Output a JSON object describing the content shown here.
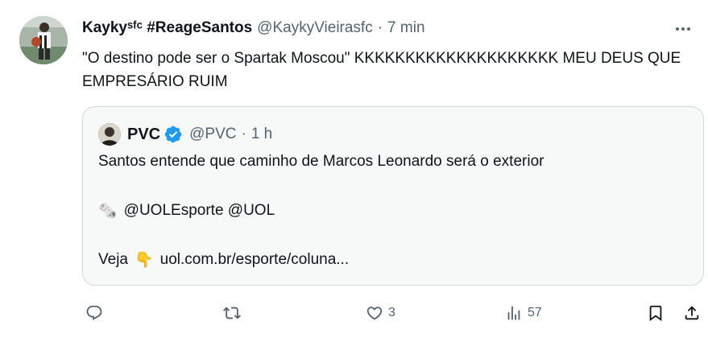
{
  "tweet": {
    "author_name": "Kaykyˢᶠᶜ #ReageSantos",
    "author_handle": "@KaykyVieirasfc",
    "separator": "·",
    "time": "7 min",
    "text": "\"O destino pode ser o Spartak Moscou\" KKKKKKKKKKKKKKKKKKKK MEU DEUS QUE EMPRESÁRIO RUIM"
  },
  "quote": {
    "author_name": "PVC",
    "author_handle": "@PVC",
    "separator": "·",
    "time": "1 h",
    "line1": "Santos entende que caminho de Marcos Leonardo será o exterior",
    "line2_emoji": "🗞️",
    "line2_text": "@UOLEsporte @UOL",
    "line3_text": "Veja",
    "line3_emoji": "👇",
    "line3_link": "uol.com.br/esporte/coluna..."
  },
  "actions": {
    "reply_count": "",
    "retweet_count": "",
    "like_count": "3",
    "views_count": "57"
  },
  "colors": {
    "text_primary": "#0f1419",
    "text_secondary": "#536471",
    "verified_blue": "#1d9bf0",
    "quote_border": "#cfd9de",
    "quote_bg": "#f7f9f9"
  },
  "icons": {
    "more": "more-icon",
    "verified": "verified-badge-icon",
    "reply": "reply-icon",
    "retweet": "retweet-icon",
    "like": "like-icon",
    "views": "views-icon",
    "bookmark": "bookmark-icon",
    "share": "share-icon"
  }
}
